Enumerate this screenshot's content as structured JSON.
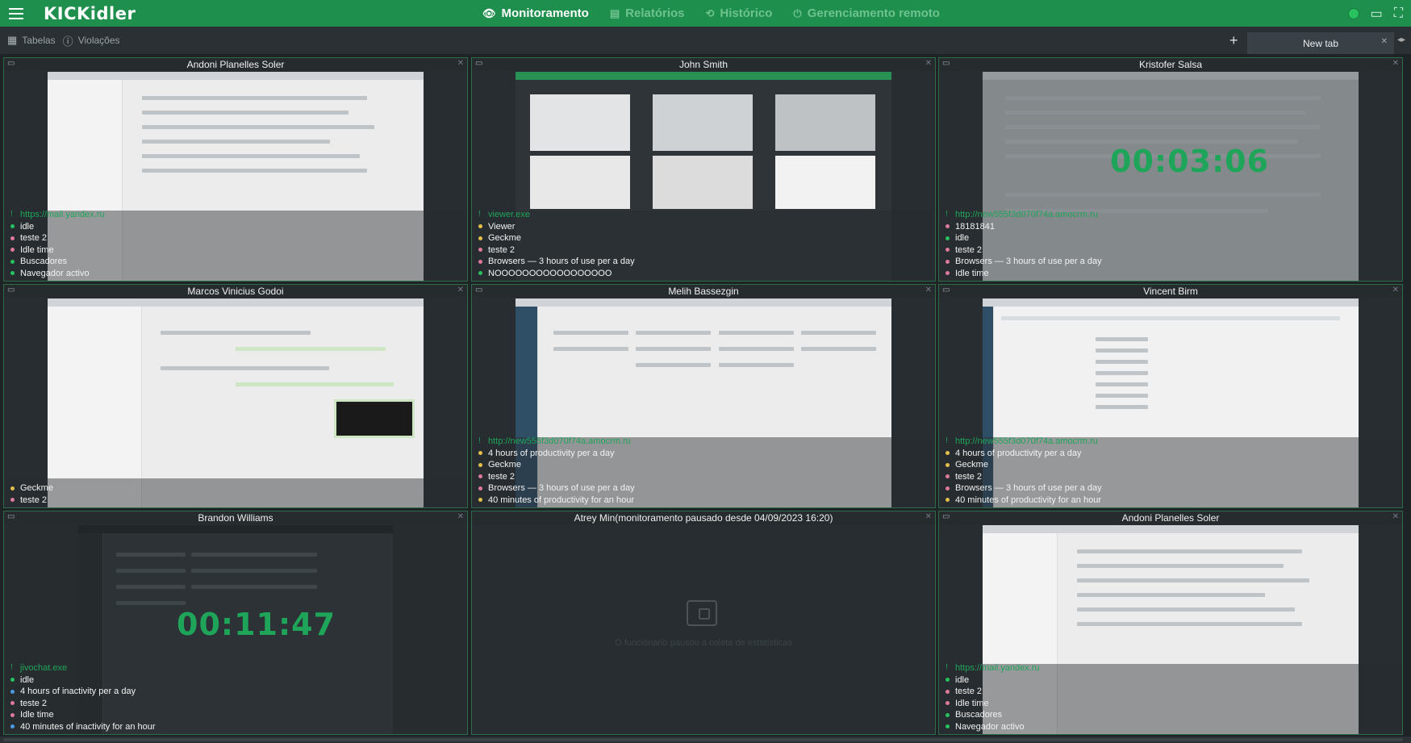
{
  "app": {
    "logo": "KICKidler"
  },
  "nav": {
    "monitoring": "Monitoramento",
    "reports": "Relatórios",
    "history": "Histórico",
    "remote": "Gerenciamento remoto"
  },
  "subbar": {
    "tables": "Tabelas",
    "violations": "Violações",
    "new_tab": "New tab"
  },
  "colors": {
    "accent": "#1f8f4e",
    "timer": "#1fa55a",
    "dot_green": "#27c15f",
    "dot_pink": "#e07a9a",
    "dot_yellow": "#e3c04a",
    "dot_blue": "#4a9be3"
  },
  "tiles": [
    {
      "title": "Andoni Planelles Soler",
      "url": "https://mail.yandex.ru",
      "lines": [
        "idle",
        "teste 2",
        "Idle time",
        "Buscadores",
        "Navegador activo"
      ]
    },
    {
      "title": "John Smith",
      "url": "viewer.exe",
      "lines": [
        "Viewer",
        "Geckme",
        "teste 2",
        "Browsers — 3 hours of use per a day",
        "NOOOOOOOOOOOOOOOOO"
      ]
    },
    {
      "title": "Kristofer Salsa",
      "timer": "00:03:06",
      "url": "http://new555f3d070f74a.amocrm.ru",
      "lines": [
        "18181841",
        "idle",
        "teste 2",
        "Browsers — 3 hours of use per a day",
        "Idle time"
      ]
    },
    {
      "title": "Marcos Vinicius Godoi",
      "lines": [
        "Geckme",
        "teste 2"
      ]
    },
    {
      "title": "Melih Bassezgin",
      "url": "http://new555f3d070f74a.amocrm.ru",
      "lines": [
        "4 hours of productivity per a day",
        "Geckme",
        "teste 2",
        "Browsers — 3 hours of use per a day",
        "40 minutes of productivity for an hour"
      ]
    },
    {
      "title": "Vincent Birm",
      "url": "http://new555f3d070f74a.amocrm.ru",
      "lines": [
        "4 hours of productivity per a day",
        "Geckme",
        "teste 2",
        "Browsers — 3 hours of use per a day",
        "40 minutes of productivity for an hour"
      ]
    },
    {
      "title": "Brandon Williams",
      "timer": "00:11:47",
      "url": "jivochat.exe",
      "lines": [
        "idle",
        "4 hours of inactivity per a day",
        "teste 2",
        "Idle time",
        "40 minutes of inactivity for an hour"
      ]
    },
    {
      "title": "Atrey Min(monitoramento pausado desde 04/09/2023 16:20)",
      "paused_text": "O funcionário pausou a coleta de estatísticas"
    },
    {
      "title": "Andoni Planelles Soler",
      "url": "https://mail.yandex.ru",
      "lines": [
        "idle",
        "teste 2",
        "Idle time",
        "Buscadores",
        "Navegador activo"
      ]
    }
  ]
}
